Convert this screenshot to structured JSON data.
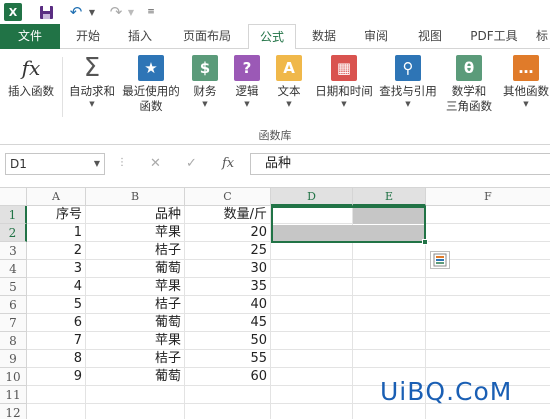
{
  "app": {
    "logo_text": "X",
    "tabs": [
      "文件",
      "开始",
      "插入",
      "页面布局",
      "公式",
      "数据",
      "审阅",
      "视图",
      "PDF工具",
      "标"
    ]
  },
  "ribbon": {
    "buttons": [
      {
        "label": "插入函数",
        "icon": "fx-icon",
        "symbol": "fx"
      },
      {
        "label": "自动求和",
        "icon": "sigma-icon",
        "symbol": "Σ"
      },
      {
        "label": "最近使用的\n函数",
        "icon": "star-icon",
        "symbol": "★"
      },
      {
        "label": "财务",
        "icon": "coins-icon",
        "symbol": "$"
      },
      {
        "label": "逻辑",
        "icon": "question-icon",
        "symbol": "?"
      },
      {
        "label": "文本",
        "icon": "text-a-icon",
        "symbol": "A"
      },
      {
        "label": "日期和时间",
        "icon": "calendar-icon",
        "symbol": "▦"
      },
      {
        "label": "查找与引用",
        "icon": "search-icon",
        "symbol": "⚲"
      },
      {
        "label": "数学和\n三角函数",
        "icon": "theta-icon",
        "symbol": "θ"
      },
      {
        "label": "其他函数",
        "icon": "more-functions-icon",
        "symbol": "…"
      }
    ],
    "group_label": "函数库"
  },
  "formula_bar": {
    "name_box": "D1",
    "cancel": "✕",
    "enter": "✓",
    "fx": "fx",
    "content": "品种"
  },
  "grid": {
    "columns": [
      "A",
      "B",
      "C",
      "D",
      "E",
      "F"
    ],
    "rows": [
      "1",
      "2",
      "3",
      "4",
      "5",
      "6",
      "7",
      "8",
      "9",
      "10",
      "11",
      "12"
    ],
    "data": [
      [
        "序号",
        "品种",
        "数量/斤"
      ],
      [
        "1",
        "苹果",
        "20"
      ],
      [
        "2",
        "桔子",
        "25"
      ],
      [
        "3",
        "葡萄",
        "30"
      ],
      [
        "4",
        "苹果",
        "35"
      ],
      [
        "5",
        "桔子",
        "40"
      ],
      [
        "6",
        "葡萄",
        "45"
      ],
      [
        "7",
        "苹果",
        "50"
      ],
      [
        "8",
        "桔子",
        "55"
      ],
      [
        "9",
        "葡萄",
        "60"
      ]
    ]
  },
  "watermark": "UiBQ.CoM"
}
